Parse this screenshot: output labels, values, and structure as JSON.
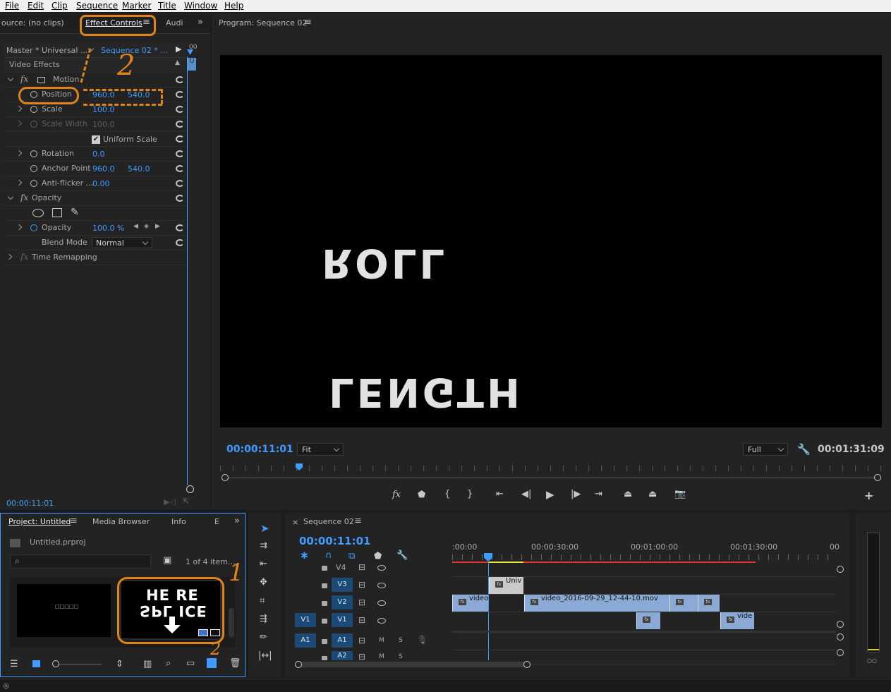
{
  "menu": [
    "File",
    "Edit",
    "Clip",
    "Sequence",
    "Marker",
    "Title",
    "Window",
    "Help"
  ],
  "source_panel": {
    "tabs": [
      "ource: (no clips)",
      "Effect Controls",
      "Audi"
    ],
    "master_label": "Master * Universal ...",
    "sequence_label": "Sequence 02 * ...",
    "mini_timecode": "00",
    "video_effects": "Video Effects",
    "motion": "Motion",
    "position_label": "Position",
    "position_x": "960.0",
    "position_y": "540.0",
    "scale_label": "Scale",
    "scale_value": "100.0",
    "scale_width_label": "Scale Width",
    "scale_width_value": "100.0",
    "uniform_scale": "Uniform Scale",
    "rotation_label": "Rotation",
    "rotation_value": "0.0",
    "anchor_label": "Anchor Point",
    "anchor_x": "960.0",
    "anchor_y": "540.0",
    "antiflicker_label": "Anti-flicker ...",
    "antiflicker_value": "0.00",
    "opacity_section": "Opacity",
    "opacity_label": "Opacity",
    "opacity_value": "100.0 %",
    "blend_label": "Blend Mode",
    "blend_value": "Normal",
    "time_remap": "Time Remapping",
    "timecode": "00:00:11:01"
  },
  "program_monitor": {
    "title": "Program: Sequence 02",
    "frame_text_top": "ROLL",
    "frame_text_bottom": "LENGTH",
    "timecode": "00:00:11:01",
    "fit": "Fit",
    "quality": "Full",
    "duration": "00:01:31:09"
  },
  "project_panel": {
    "tabs": [
      "Project: Untitled",
      "Media Browser",
      "Info",
      "E"
    ],
    "file": "Untitled.prproj",
    "items_count": "1 of 4 item...",
    "thumb1_text": "□□□□□",
    "thumb2_top": "HE RE",
    "thumb2_mid": "SPL ICE"
  },
  "timeline": {
    "title": "Sequence 02",
    "timecode": "00:00:11:01",
    "ruler": [
      ":00:00",
      "00:00:30:00",
      "00:01:00:00",
      "00:01:30:00",
      "00"
    ],
    "tracks": [
      "V4",
      "V3",
      "V2",
      "V1",
      "A1",
      "A2"
    ],
    "src_v1": "V1",
    "src_a1": "A1",
    "clips": {
      "v3_clip": "Univ",
      "v2_clip_a": "video",
      "v2_clip_b": "video_2016-09-29_12-44-10.mov",
      "v1_clip": "vide"
    },
    "m": "M",
    "s": "S"
  },
  "annotations": [
    "1",
    "2",
    "1",
    "2"
  ],
  "colors": {
    "accent": "#3f9bff",
    "highlight": "#e0841a",
    "clip": "#8aa9d4",
    "playhead": "#3f9bff"
  }
}
